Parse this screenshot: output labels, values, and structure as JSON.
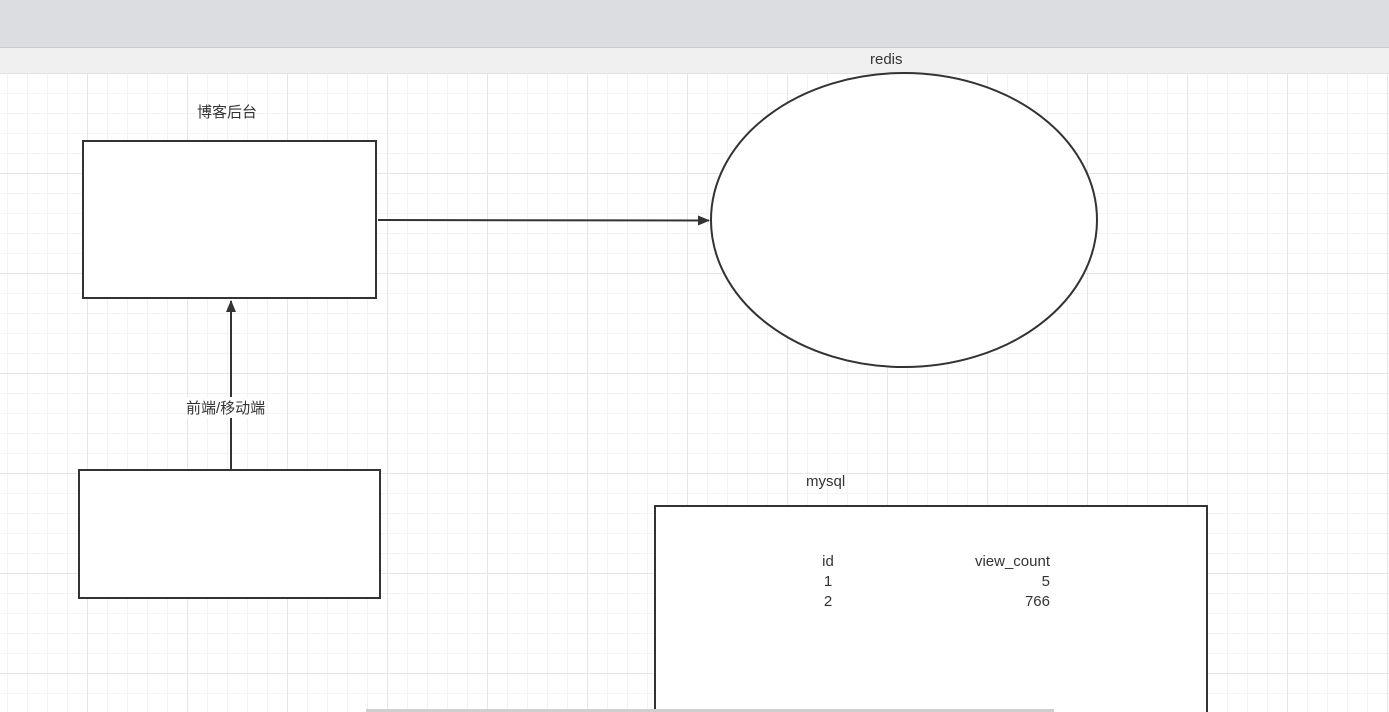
{
  "diagram": {
    "labels": {
      "blog_backend": "博客后台",
      "redis": "redis",
      "frontend_mobile": "前端/移动端",
      "mysql": "mysql"
    },
    "mysql_table": {
      "columns": [
        "id",
        "view_count"
      ],
      "rows": [
        [
          "1",
          "5"
        ],
        [
          "2",
          "766"
        ]
      ]
    }
  }
}
